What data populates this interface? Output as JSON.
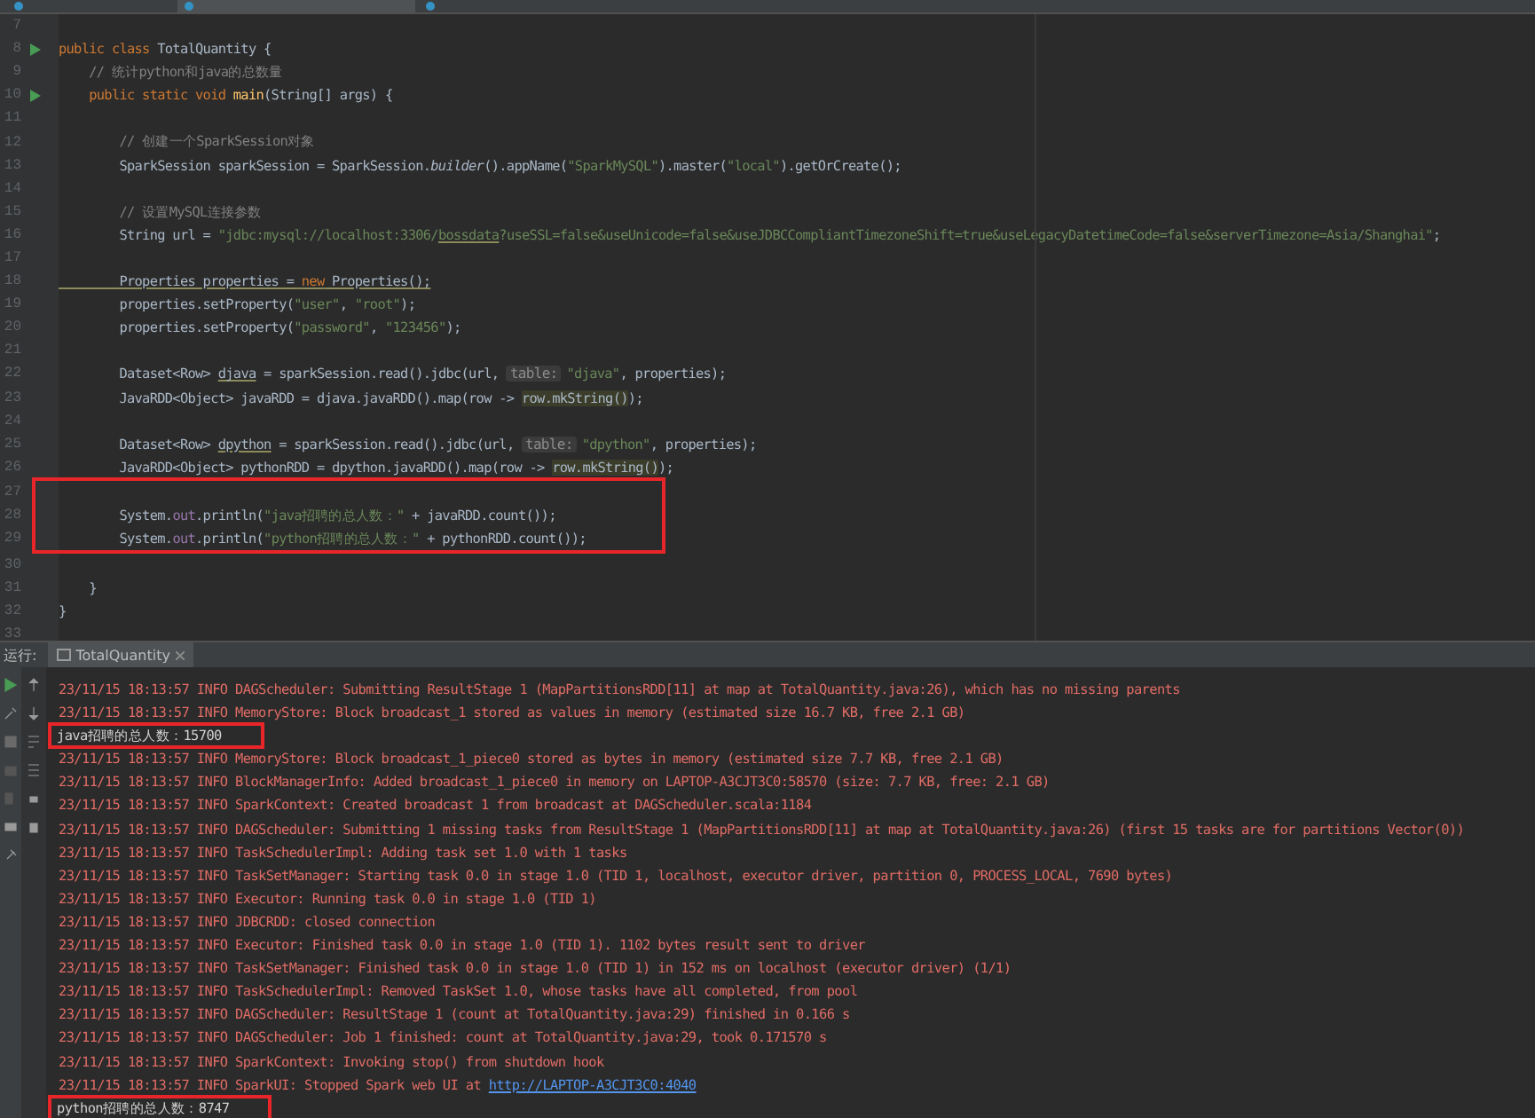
{
  "editor_tabs": [
    {
      "selected": false
    },
    {
      "selected": true
    },
    {
      "selected": false
    }
  ],
  "editor": {
    "lines": [
      {
        "number": "7"
      },
      {
        "number": "8",
        "run": true,
        "tokens": [
          {
            "kind": "keyword",
            "text": "public class "
          },
          {
            "kind": "plain",
            "text": "TotalQuantity {"
          }
        ]
      },
      {
        "number": "9",
        "tokens": [
          {
            "kind": "comment",
            "text": "    // 统计python和java的总数量"
          }
        ]
      },
      {
        "number": "10",
        "run": true,
        "tokens": [
          {
            "kind": "keyword",
            "text": "    public static void "
          },
          {
            "kind": "method",
            "text": "main"
          },
          {
            "kind": "plain",
            "text": "(String[] args) {"
          }
        ]
      },
      {
        "number": "11"
      },
      {
        "number": "12",
        "tokens": [
          {
            "kind": "comment",
            "text": "        // 创建一个SparkSession对象"
          }
        ]
      },
      {
        "number": "13",
        "tokens": [
          {
            "kind": "plain",
            "text": "        SparkSession sparkSession = SparkSession."
          },
          {
            "kind": "static",
            "text": "builder"
          },
          {
            "kind": "plain",
            "text": "().appName("
          },
          {
            "kind": "string",
            "text": "\"SparkMySQL\""
          },
          {
            "kind": "plain",
            "text": ").master("
          },
          {
            "kind": "string",
            "text": "\"local\""
          },
          {
            "kind": "plain",
            "text": ").getOrCreate();"
          }
        ]
      },
      {
        "number": "14"
      },
      {
        "number": "15",
        "tokens": [
          {
            "kind": "comment",
            "text": "        // 设置MySQL连接参数"
          }
        ]
      },
      {
        "number": "16",
        "tokens": [
          {
            "kind": "plain",
            "text": "        String url = "
          },
          {
            "kind": "string",
            "text": "\"jdbc:mysql://localhost:3306/"
          },
          {
            "kind": "string_underline",
            "text": "bossdata"
          },
          {
            "kind": "string",
            "text": "?useSSL=false&useUnicode=false&useJDBCCompliantTimezoneShift=true&useLegacyDatetimeCode=false&serverTimezone=Asia/Shanghai\""
          },
          {
            "kind": "plain",
            "text": ";"
          }
        ]
      },
      {
        "number": "17"
      },
      {
        "number": "18",
        "tokens": [
          {
            "kind": "warning",
            "text": "        Properties properties = "
          },
          {
            "kind": "warning_keyword",
            "text": "new"
          },
          {
            "kind": "warning",
            "text": " Properties();"
          }
        ]
      },
      {
        "number": "19",
        "tokens": [
          {
            "kind": "plain",
            "text": "        properties.setProperty("
          },
          {
            "kind": "string",
            "text": "\"user\""
          },
          {
            "kind": "plain",
            "text": ", "
          },
          {
            "kind": "string",
            "text": "\"root\""
          },
          {
            "kind": "plain",
            "text": ");"
          }
        ]
      },
      {
        "number": "20",
        "tokens": [
          {
            "kind": "plain",
            "text": "        properties.setProperty("
          },
          {
            "kind": "string",
            "text": "\"password\""
          },
          {
            "kind": "plain",
            "text": ", "
          },
          {
            "kind": "string",
            "text": "\"123456\""
          },
          {
            "kind": "plain",
            "text": ");"
          }
        ]
      },
      {
        "number": "21"
      },
      {
        "number": "22",
        "tokens": [
          {
            "kind": "plain",
            "text": "        Dataset<Row> "
          },
          {
            "kind": "warning",
            "text": "djava"
          },
          {
            "kind": "plain",
            "text": " = sparkSession.read().jdbc(url, "
          },
          {
            "kind": "hint",
            "text": "table:"
          },
          {
            "kind": "string",
            "text": "\"djava\""
          },
          {
            "kind": "plain",
            "text": ", properties);"
          }
        ]
      },
      {
        "number": "23",
        "tokens": [
          {
            "kind": "plain",
            "text": "        JavaRDD<Object> javaRDD = djava.javaRDD().map(row -> "
          },
          {
            "kind": "highlight",
            "text": "row.mkString()"
          },
          {
            "kind": "plain",
            "text": ");"
          }
        ]
      },
      {
        "number": "24"
      },
      {
        "number": "25",
        "tokens": [
          {
            "kind": "plain",
            "text": "        Dataset<Row> "
          },
          {
            "kind": "warning",
            "text": "dpython"
          },
          {
            "kind": "plain",
            "text": " = sparkSession.read().jdbc(url, "
          },
          {
            "kind": "hint",
            "text": "table:"
          },
          {
            "kind": "string",
            "text": "\"dpython\""
          },
          {
            "kind": "plain",
            "text": ", properties);"
          }
        ]
      },
      {
        "number": "26",
        "tokens": [
          {
            "kind": "plain",
            "text": "        JavaRDD<Object> pythonRDD = dpython.javaRDD().map(row -> "
          },
          {
            "kind": "highlight",
            "text": "row.mkString()"
          },
          {
            "kind": "plain",
            "text": ");"
          }
        ]
      },
      {
        "number": "27",
        "boxed": true
      },
      {
        "number": "28",
        "boxed": true,
        "tokens": [
          {
            "kind": "plain",
            "text": "        System."
          },
          {
            "kind": "field",
            "text": "out"
          },
          {
            "kind": "plain",
            "text": ".println("
          },
          {
            "kind": "string",
            "text": "\"java招聘的总人数：\""
          },
          {
            "kind": "plain",
            "text": " + javaRDD.count());"
          }
        ]
      },
      {
        "number": "29",
        "boxed": true,
        "tokens": [
          {
            "kind": "plain",
            "text": "        System."
          },
          {
            "kind": "field",
            "text": "out"
          },
          {
            "kind": "plain",
            "text": ".println("
          },
          {
            "kind": "string",
            "text": "\"python招聘的总人数：\""
          },
          {
            "kind": "plain",
            "text": " + pythonRDD.count());"
          }
        ]
      },
      {
        "number": "30"
      },
      {
        "number": "31",
        "tokens": [
          {
            "kind": "plain",
            "text": "    }"
          }
        ]
      },
      {
        "number": "32",
        "tokens": [
          {
            "kind": "plain",
            "text": "}"
          }
        ]
      },
      {
        "number": "33"
      }
    ]
  },
  "run_panel": {
    "label": "运行:",
    "tab": "TotalQuantity",
    "lines": [
      {
        "kind": "log",
        "text": "23/11/15 18:13:57 INFO DAGScheduler: Submitting ResultStage 1 (MapPartitionsRDD[11] at map at TotalQuantity.java:26), which has no missing parents"
      },
      {
        "kind": "log",
        "text": "23/11/15 18:13:57 INFO MemoryStore: Block broadcast_1 stored as values in memory (estimated size 16.7 KB, free 2.1 GB)"
      },
      {
        "kind": "output",
        "boxed": true,
        "text": "java招聘的总人数：15700"
      },
      {
        "kind": "log",
        "text": "23/11/15 18:13:57 INFO MemoryStore: Block broadcast_1_piece0 stored as bytes in memory (estimated size 7.7 KB, free 2.1 GB)"
      },
      {
        "kind": "log",
        "text": "23/11/15 18:13:57 INFO BlockManagerInfo: Added broadcast_1_piece0 in memory on LAPTOP-A3CJT3C0:58570 (size: 7.7 KB, free: 2.1 GB)"
      },
      {
        "kind": "log",
        "text": "23/11/15 18:13:57 INFO SparkContext: Created broadcast 1 from broadcast at DAGScheduler.scala:1184"
      },
      {
        "kind": "log",
        "text": "23/11/15 18:13:57 INFO DAGScheduler: Submitting 1 missing tasks from ResultStage 1 (MapPartitionsRDD[11] at map at TotalQuantity.java:26) (first 15 tasks are for partitions Vector(0))"
      },
      {
        "kind": "log",
        "text": "23/11/15 18:13:57 INFO TaskSchedulerImpl: Adding task set 1.0 with 1 tasks"
      },
      {
        "kind": "log",
        "text": "23/11/15 18:13:57 INFO TaskSetManager: Starting task 0.0 in stage 1.0 (TID 1, localhost, executor driver, partition 0, PROCESS_LOCAL, 7690 bytes)"
      },
      {
        "kind": "log",
        "text": "23/11/15 18:13:57 INFO Executor: Running task 0.0 in stage 1.0 (TID 1)"
      },
      {
        "kind": "log",
        "text": "23/11/15 18:13:57 INFO JDBCRDD: closed connection"
      },
      {
        "kind": "log",
        "text": "23/11/15 18:13:57 INFO Executor: Finished task 0.0 in stage 1.0 (TID 1). 1102 bytes result sent to driver"
      },
      {
        "kind": "log",
        "text": "23/11/15 18:13:57 INFO TaskSetManager: Finished task 0.0 in stage 1.0 (TID 1) in 152 ms on localhost (executor driver) (1/1)"
      },
      {
        "kind": "log",
        "text": "23/11/15 18:13:57 INFO TaskSchedulerImpl: Removed TaskSet 1.0, whose tasks have all completed, from pool"
      },
      {
        "kind": "log",
        "text": "23/11/15 18:13:57 INFO DAGScheduler: ResultStage 1 (count at TotalQuantity.java:29) finished in 0.166 s"
      },
      {
        "kind": "log",
        "text": "23/11/15 18:13:57 INFO DAGScheduler: Job 1 finished: count at TotalQuantity.java:29, took 0.171570 s"
      },
      {
        "kind": "log",
        "text": "23/11/15 18:13:57 INFO SparkContext: Invoking stop() from shutdown hook"
      },
      {
        "kind": "log",
        "text": "23/11/15 18:13:57 INFO SparkUI: Stopped Spark web UI at ",
        "link": "http://LAPTOP-A3CJT3C0:4040"
      },
      {
        "kind": "output",
        "boxed": true,
        "text": "python招聘的总人数：8747"
      }
    ]
  }
}
